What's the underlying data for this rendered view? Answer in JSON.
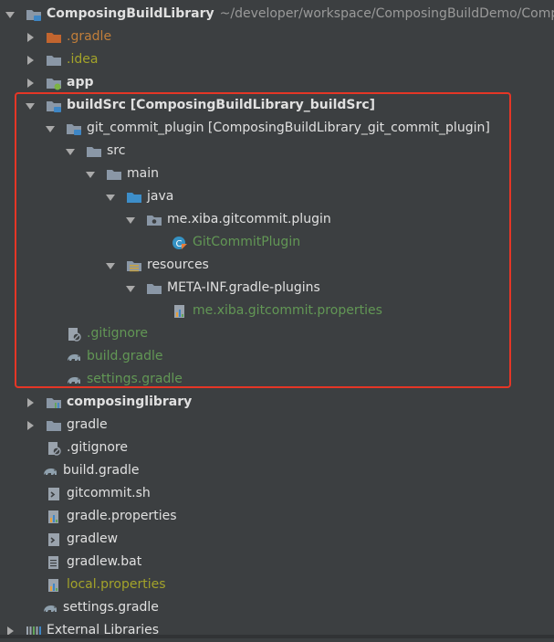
{
  "tree": {
    "root": {
      "label": "ComposingBuildLibrary",
      "path": "~/developer/workspace/ComposingBuildDemo/Compo"
    },
    "items": [
      {
        "label": ".gradle",
        "color": "#c17e3a"
      },
      {
        "label": ".idea",
        "color": "#a3a32a"
      },
      {
        "label": "app",
        "color": "#e0e0e0"
      },
      {
        "label": "buildSrc [ComposingBuildLibrary_buildSrc]",
        "color": "#e0e0e0"
      },
      {
        "label": "git_commit_plugin [ComposingBuildLibrary_git_commit_plugin]",
        "color": "#e0e0e0"
      },
      {
        "label": "src",
        "color": "#e0e0e0"
      },
      {
        "label": "main",
        "color": "#e0e0e0"
      },
      {
        "label": "java",
        "color": "#e0e0e0"
      },
      {
        "label": "me.xiba.gitcommit.plugin",
        "color": "#e0e0e0"
      },
      {
        "label": "GitCommitPlugin",
        "color": "#629755"
      },
      {
        "label": "resources",
        "color": "#e0e0e0"
      },
      {
        "label": "META-INF.gradle-plugins",
        "color": "#e0e0e0"
      },
      {
        "label": "me.xiba.gitcommit.properties",
        "color": "#629755"
      },
      {
        "label": ".gitignore",
        "color": "#629755"
      },
      {
        "label": "build.gradle",
        "color": "#629755"
      },
      {
        "label": "settings.gradle",
        "color": "#629755"
      },
      {
        "label": "composinglibrary",
        "color": "#e0e0e0"
      },
      {
        "label": "gradle",
        "color": "#e0e0e0"
      },
      {
        "label": ".gitignore",
        "color": "#e0e0e0"
      },
      {
        "label": "build.gradle",
        "color": "#e0e0e0"
      },
      {
        "label": "gitcommit.sh",
        "color": "#e0e0e0"
      },
      {
        "label": "gradle.properties",
        "color": "#e0e0e0"
      },
      {
        "label": "gradlew",
        "color": "#e0e0e0"
      },
      {
        "label": "gradlew.bat",
        "color": "#e0e0e0"
      },
      {
        "label": "local.properties",
        "color": "#a3a32a"
      },
      {
        "label": "settings.gradle",
        "color": "#e0e0e0"
      },
      {
        "label": "External Libraries",
        "color": "#e0e0e0"
      }
    ]
  },
  "highlight": {
    "color": "#e53626"
  }
}
